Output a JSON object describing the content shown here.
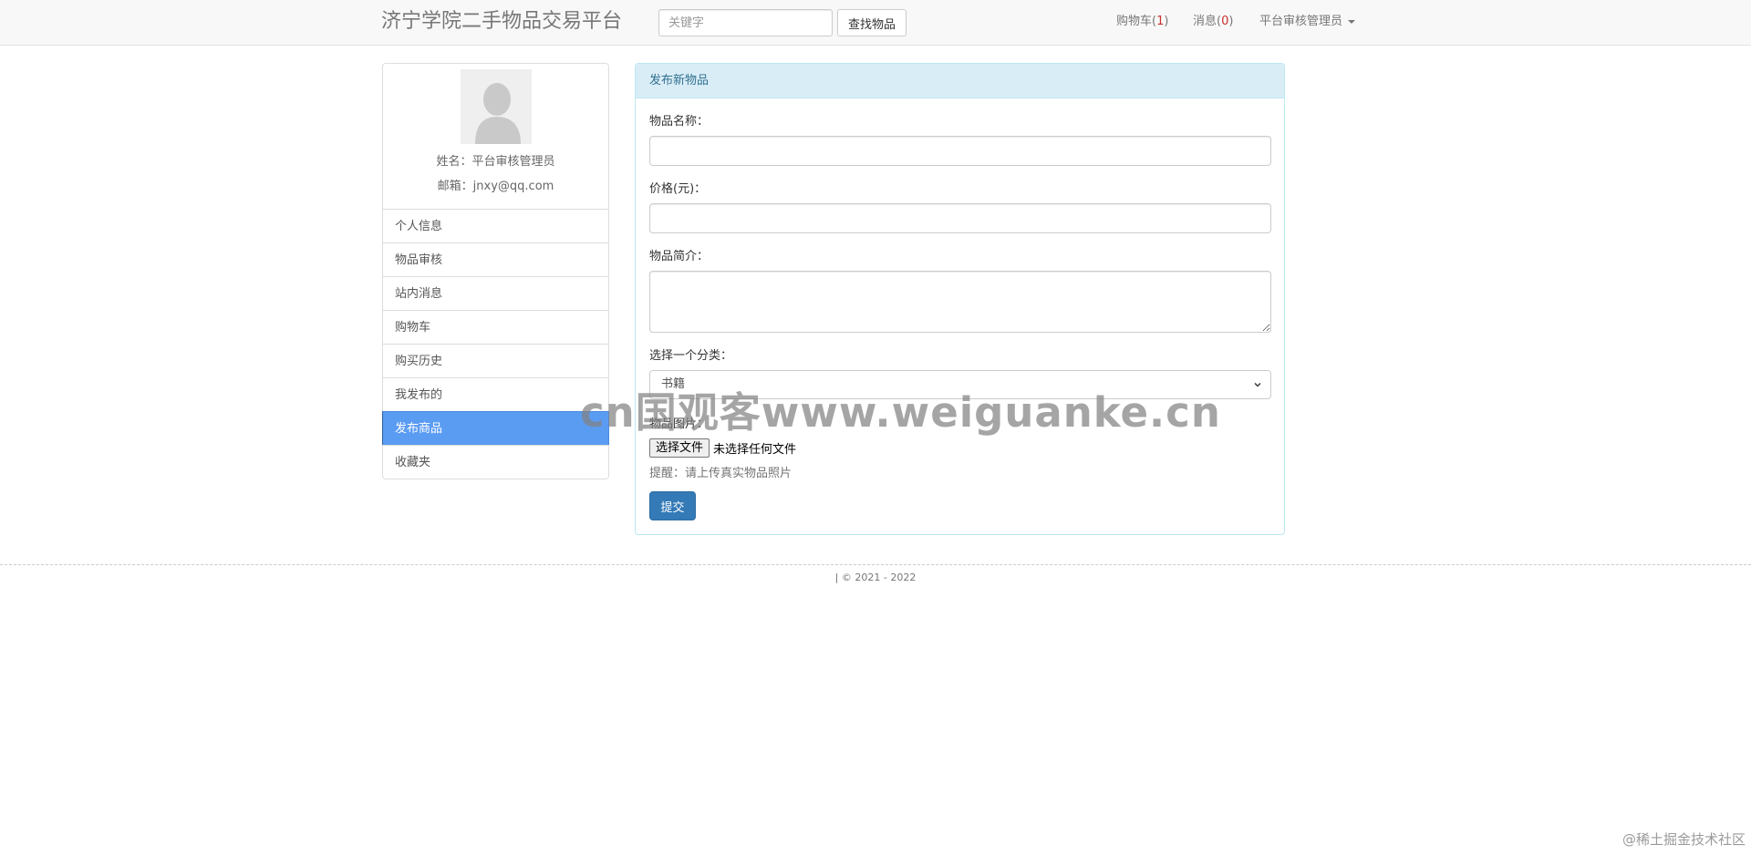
{
  "navbar": {
    "brand": "济宁学院二手物品交易平台",
    "search_placeholder": "关键字",
    "search_button": "查找物品",
    "cart_label": "购物车(",
    "cart_count": "1",
    "cart_suffix": ")",
    "messages_label": "消息(",
    "messages_count": "0",
    "messages_suffix": ")",
    "user_menu": "平台审核管理员"
  },
  "profile": {
    "name_line": "姓名：平台审核管理员",
    "email_line": "邮箱：jnxy@qq.com"
  },
  "sidebar": {
    "items": [
      {
        "label": "个人信息"
      },
      {
        "label": "物品审核"
      },
      {
        "label": "站内消息"
      },
      {
        "label": "购物车"
      },
      {
        "label": "购买历史"
      },
      {
        "label": "我发布的"
      },
      {
        "label": "发布商品",
        "active": true
      },
      {
        "label": "收藏夹"
      }
    ]
  },
  "form": {
    "heading": "发布新物品",
    "name_label": "物品名称：",
    "name_value": "",
    "price_label": "价格(元)：",
    "price_value": "",
    "desc_label": "物品简介：",
    "desc_value": "",
    "category_label": "选择一个分类：",
    "category_selected": "书籍",
    "image_label": "物品图片：",
    "file_button": "选择文件",
    "file_status": "未选择任何文件",
    "hint": "提醒：请上传真实物品照片",
    "submit": "提交"
  },
  "footer": {
    "text": "| © 2021 - 2022"
  },
  "overlays": {
    "watermark": "cn国观客www.weiguanke.cn",
    "corner_mark": "@稀土掘金技术社区"
  },
  "colors": {
    "navbar_bg": "#f8f8f8",
    "active_item": "#5b9cf3",
    "panel_heading_bg": "#d9edf7",
    "panel_heading_text": "#31708f",
    "submit_bg": "#337ab7",
    "count_red": "#c9302c"
  },
  "icons": {
    "user_menu_caret": "caret-down-icon",
    "select_arrow": "chevron-down-icon",
    "avatar": "default-avatar-silhouette"
  }
}
